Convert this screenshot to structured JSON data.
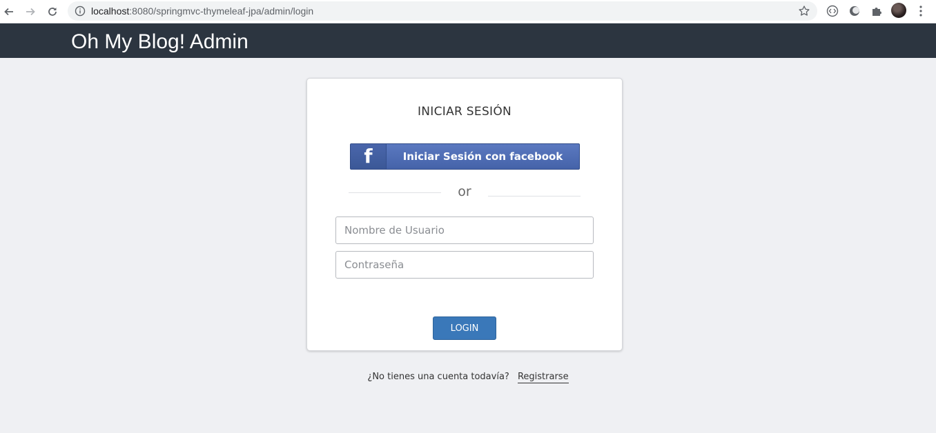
{
  "browser": {
    "url_host": "localhost",
    "url_rest": ":8080/springmvc-thymeleaf-jpa/admin/login",
    "icons": {
      "back": "arrow-left-icon",
      "forward": "arrow-right-icon",
      "reload": "reload-icon",
      "info": "info-icon",
      "bookmark": "star-icon",
      "extensions": [
        "code-icon",
        "moon-icon",
        "puzzle-icon"
      ],
      "menu": "more-vert-icon"
    }
  },
  "app": {
    "brand": "Oh My Blog! Admin",
    "header_color": "#2c3540"
  },
  "login": {
    "title": "INICIAR SESIÓN",
    "facebook_button": "Iniciar Sesión con facebook",
    "facebook_icon": "f",
    "or": "or",
    "username_placeholder": "Nombre de Usuario",
    "password_placeholder": "Contraseña",
    "submit": "LOGIN",
    "submit_color": "#3a78b9"
  },
  "signup": {
    "prompt": "¿No tienes una cuenta todavía?",
    "link": "Registrarse"
  }
}
